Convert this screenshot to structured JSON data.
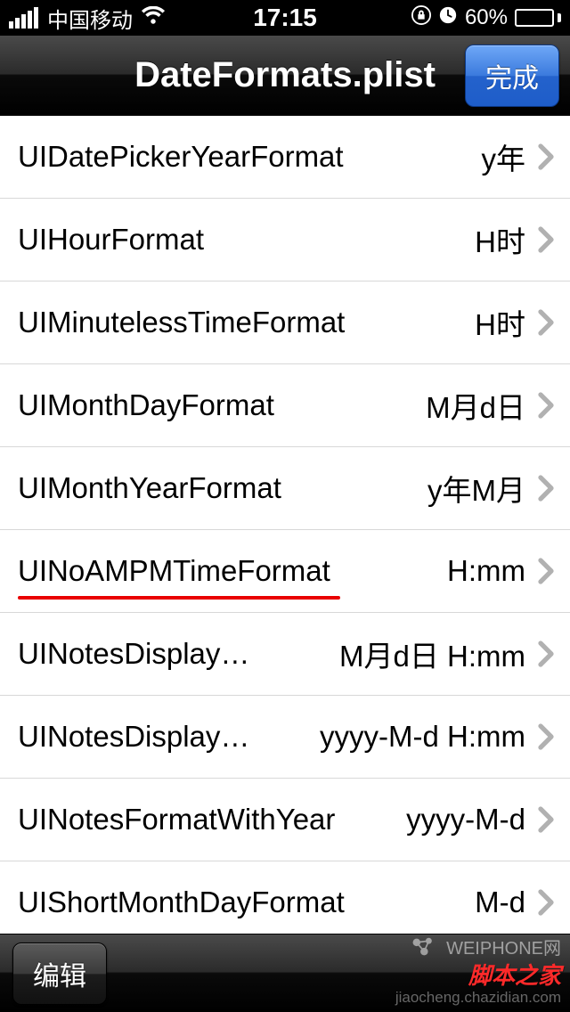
{
  "status": {
    "carrier": "中国移动",
    "time": "17:15",
    "battery_pct": "60%"
  },
  "nav": {
    "title": "DateFormats.plist",
    "done_label": "完成"
  },
  "rows": [
    {
      "key": "UIDatePickerYearFormat",
      "value": "y年",
      "highlight": false
    },
    {
      "key": "UIHourFormat",
      "value": "H时",
      "highlight": false
    },
    {
      "key": "UIMinutelessTimeFormat",
      "value": "H时",
      "highlight": false
    },
    {
      "key": "UIMonthDayFormat",
      "value": "M月d日",
      "highlight": false
    },
    {
      "key": "UIMonthYearFormat",
      "value": "y年M月",
      "highlight": false
    },
    {
      "key": "UINoAMPMTimeFormat",
      "value": "H:mm",
      "highlight": true,
      "underline_width": 362
    },
    {
      "key": "UINotesDisplay…",
      "value": "M月d日  H:mm",
      "highlight": false
    },
    {
      "key": "UINotesDisplay…",
      "value": "yyyy-M-d  H:mm",
      "highlight": false
    },
    {
      "key": "UINotesFormatWithYear",
      "value": "yyyy-M-d",
      "highlight": false
    },
    {
      "key": "UIShortMonthDayFormat",
      "value": "M-d",
      "highlight": false
    }
  ],
  "toolbar": {
    "edit_label": "编辑"
  },
  "watermarks": {
    "w1": "WEIPHONE网",
    "w2": "脚本之家",
    "w3": "jiaocheng.chazidian.com"
  }
}
